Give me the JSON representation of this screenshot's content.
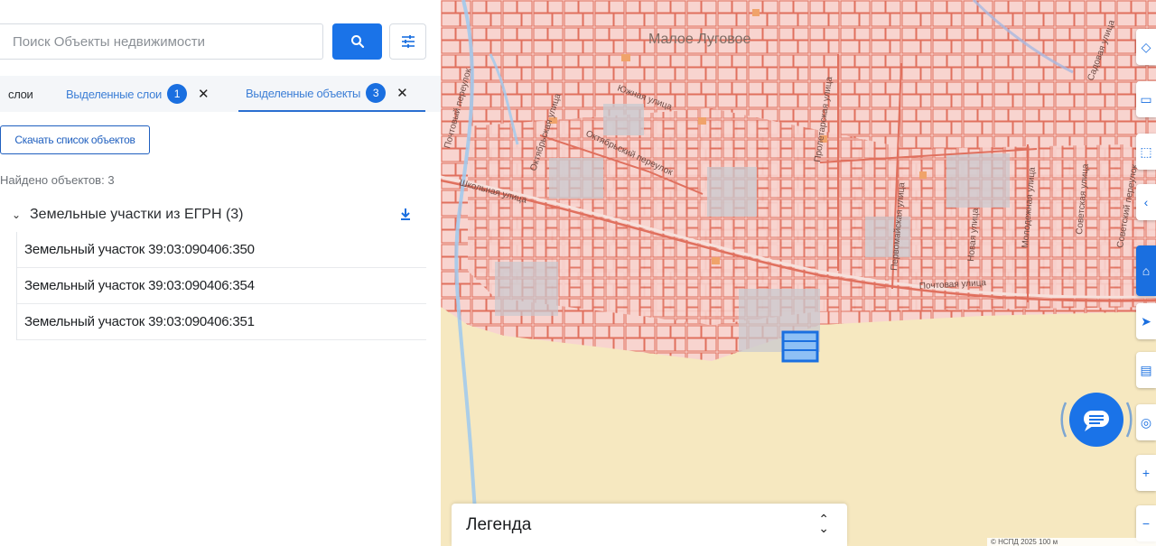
{
  "search": {
    "placeholder": "Поиск Объекты недвижимости",
    "search_button_icon": "search-icon",
    "filter_button_icon": "filter-sliders-icon"
  },
  "tabs": [
    {
      "label": "слои"
    },
    {
      "label": "Выделенные слои",
      "count": "1"
    },
    {
      "label": "Выделенные объекты",
      "count": "3",
      "active": true
    }
  ],
  "actions": {
    "download_list_label": "Скачать список объектов"
  },
  "results": {
    "found_label": "Найдено объектов: 3",
    "group_title": "Земельные участки из ЕГРН (3)",
    "items": [
      {
        "label": "Земельный участок 39:03:090406:350"
      },
      {
        "label": "Земельный участок 39:03:090406:354"
      },
      {
        "label": "Земельный участок 39:03:090406:351"
      }
    ]
  },
  "map": {
    "place_label": "Малое Луговое",
    "street_labels": [
      "Октябрьская улица",
      "Октябрьский переулок",
      "Южная улица",
      "Пролетарская улица",
      "Первомайская улица",
      "Новая улица",
      "Молодежная улица",
      "Советская улица",
      "Советский переулок",
      "Садовая улица",
      "Почтовый переулок",
      "Почтовая улица",
      "Школьная улица"
    ],
    "legend_title": "Легенда",
    "attribution": "© НСПД 2025  100 м",
    "colors": {
      "parcel_fill": "#f8d4cf",
      "parcel_stroke": "#e0705e",
      "selected_parcel": "#1a6fe0",
      "field": "#f6e8c0",
      "built_area": "#c9c9cf",
      "accent": "#1a73e8"
    }
  },
  "tools": {
    "icons": [
      "layers-icon",
      "ruler-icon",
      "select-icon",
      "share-icon",
      "selection-active-icon",
      "navigate-icon",
      "print-icon",
      "measure-icon",
      "zoom-in-icon",
      "zoom-out-icon"
    ],
    "chat_icon": "chat-icon",
    "zoom_in": "+",
    "zoom_out": "−"
  }
}
